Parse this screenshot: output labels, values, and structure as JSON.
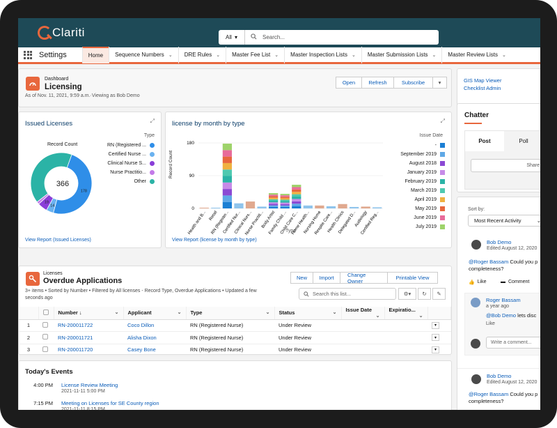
{
  "app": {
    "logo_text": "Clariti",
    "name": "Settings"
  },
  "search": {
    "scope": "All",
    "placeholder": "Search..."
  },
  "nav": {
    "items": [
      {
        "label": "Home",
        "active": true,
        "menu": false
      },
      {
        "label": "Sequence Numbers",
        "active": false,
        "menu": true
      },
      {
        "label": "DRE Rules",
        "active": false,
        "menu": true
      },
      {
        "label": "Master Fee List",
        "active": false,
        "menu": true
      },
      {
        "label": "Master Inspection Lists",
        "active": false,
        "menu": true
      },
      {
        "label": "Master Submission Lists",
        "active": false,
        "menu": true
      },
      {
        "label": "Master Review Lists",
        "active": false,
        "menu": true
      }
    ]
  },
  "dashboard": {
    "kicker": "Dashboard",
    "title": "Licensing",
    "subtitle": "As of Nov. 11, 2021, 9:59 a.m.·Viewing as Bob Demo",
    "buttons": {
      "open": "Open",
      "refresh": "Refresh",
      "subscribe": "Subscribe"
    }
  },
  "side_links": {
    "gis": "GIS Map Viewer",
    "checklist": "Checklist Admin"
  },
  "issued": {
    "title": "Issued Licenses",
    "legend_title": "Type",
    "center_label": "Record Count",
    "total": "366",
    "view_report": "View Report (Issued Licenses)",
    "chart_data": {
      "type": "pie",
      "title": "Issued Licenses",
      "total": 366,
      "legend_title": "Type",
      "categories": [
        "RN (Registered ...",
        "Certified Nurse ...",
        "Clinical Nurse S...",
        "Nurse Practitio...",
        "Other"
      ],
      "values": [
        178,
        14,
        19,
        5,
        150
      ],
      "value_labels": [
        "178",
        "14",
        "19",
        "",
        ""
      ],
      "colors": [
        "#2f8ee8",
        "#6ab2f0",
        "#8a3ed8",
        "#c37ae8",
        "#2bb3a6"
      ]
    }
  },
  "bymonth": {
    "title": "license by month by type",
    "legend_title": "Issue Date",
    "xlabel": "Type",
    "ylabel": "Record Count",
    "view_report": "View Report (license by month by type)",
    "chart_data": {
      "type": "bar",
      "stacked": true,
      "title": "license by month by type",
      "xlabel": "Type",
      "ylabel": "Record Count",
      "yticks": [
        0,
        90,
        180
      ],
      "ylim": [
        0,
        180
      ],
      "categories": [
        "Health and B...",
        "Retail",
        "RN (Register...",
        "Certified Nur...",
        "Clinical Nurs...",
        "Nurse Practiti...",
        "Body Artist",
        "Family Child ...",
        "Child Care C...",
        "Home Health...",
        "Nursing Home",
        "Respite Care...",
        "Health Clinics",
        "Delegated D...",
        "Audiology",
        "Certified Reg..."
      ],
      "totals": [
        2,
        2,
        178,
        14,
        19,
        5,
        42,
        40,
        65,
        8,
        8,
        6,
        12,
        4,
        5,
        3
      ],
      "legend": [
        "-",
        "September 2019",
        "August 2018",
        "January 2019",
        "February 2019",
        "March 2019",
        "April 2019",
        "May 2019",
        "June 2019",
        "July 2019"
      ],
      "colors": [
        "#1b7fd4",
        "#5fa8e6",
        "#8b49d4",
        "#c78be8",
        "#2bb3a6",
        "#4fc9b0",
        "#f0b140",
        "#e8673d",
        "#e86b9a",
        "#9ed36a"
      ]
    }
  },
  "overdue": {
    "kicker": "Licenses",
    "title": "Overdue Applications",
    "meta": "3+ items • Sorted by Number • Filtered by All licenses - Record Type, Overdue Applications • Updated a few seconds ago",
    "buttons": {
      "new": "New",
      "import": "Import",
      "change_owner": "Change Owner",
      "printable": "Printable View"
    },
    "search_placeholder": "Search this list...",
    "columns": [
      "Number ↓",
      "Applicant",
      "Type",
      "Status",
      "Issue Date",
      "Expiratio..."
    ],
    "rows": [
      {
        "idx": "1",
        "number": "RN-200011722",
        "applicant": "Coco Dillon",
        "type": "RN (Registered Nurse)",
        "status": "Under Review",
        "issue": "",
        "exp": ""
      },
      {
        "idx": "2",
        "number": "RN-200011721",
        "applicant": "Alisha Dixon",
        "type": "RN (Registered Nurse)",
        "status": "Under Review",
        "issue": "",
        "exp": ""
      },
      {
        "idx": "3",
        "number": "RN-200011720",
        "applicant": "Casey Bone",
        "type": "RN (Registered Nurse)",
        "status": "Under Review",
        "issue": "",
        "exp": ""
      }
    ]
  },
  "events": {
    "title": "Today's Events",
    "items": [
      {
        "time": "4:00 PM",
        "name": "License Review Meeting",
        "date": "2021-11-11 5:00 PM"
      },
      {
        "time": "7:15 PM",
        "name": "Meeting on Licenses for SE County region",
        "date": "2021-11-11 8:15 PM"
      }
    ]
  },
  "chatter": {
    "title": "Chatter",
    "tabs": {
      "post": "Post",
      "poll": "Poll"
    },
    "share": "Share",
    "sort_label": "Sort by:",
    "sort_value": "Most Recent Activity",
    "like": "Like",
    "comment": "Comment",
    "write_comment": "Write a comment...",
    "posts": [
      {
        "author": "Bob Demo",
        "date": "Edited August 12, 2020",
        "mention": "@Roger Bassam",
        "text": "Could you p",
        "text2": "completeness?"
      },
      {
        "author": "Bob Demo",
        "date": "Edited August 12, 2020",
        "mention": "@Roger Bassam",
        "text": "Could you p",
        "text2": "completeness?"
      }
    ],
    "reply": {
      "author": "Roger Bassam",
      "date": "a year ago",
      "mention": "@Bob Demo",
      "text": "lets disc",
      "like": "Like"
    }
  }
}
